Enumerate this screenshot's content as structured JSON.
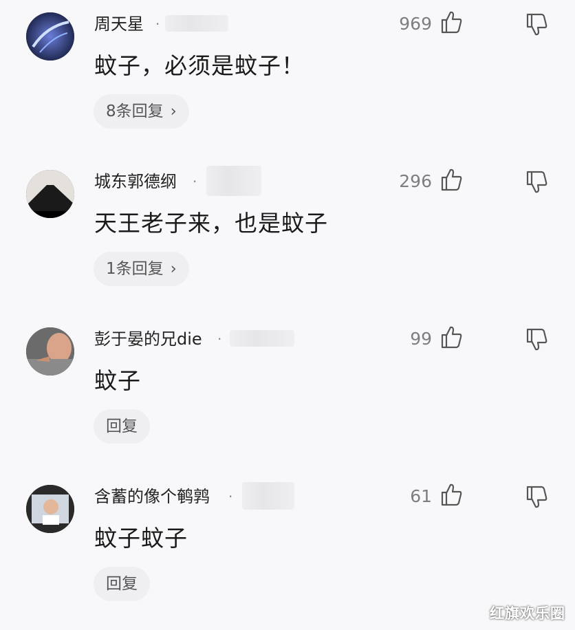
{
  "comments": [
    {
      "username": "周天星",
      "likes": "969",
      "text": "蚊子，必须是蚊子！",
      "reply_label": "8条回复",
      "has_chevron": true
    },
    {
      "username": "城东郭德纲",
      "likes": "296",
      "text": "天王老子来，也是蚊子",
      "reply_label": "1条回复",
      "has_chevron": true
    },
    {
      "username": "彭于晏的兄die",
      "likes": "99",
      "text": "蚊子",
      "reply_label": "回复",
      "has_chevron": false
    },
    {
      "username": "含蓄的像个鹌鹑",
      "likes": "61",
      "text": "蚊子蚊子",
      "reply_label": "回复",
      "has_chevron": false
    }
  ],
  "separator": "·",
  "chevron": "›",
  "watermark": "红旗欢乐圈",
  "icons": {
    "like": "thumbs-up-icon",
    "dislike": "thumbs-down-icon"
  },
  "colors": {
    "background": "#f8f8fa",
    "username": "#222222",
    "count": "#7d7d82",
    "reply_bg": "#efeff2"
  }
}
